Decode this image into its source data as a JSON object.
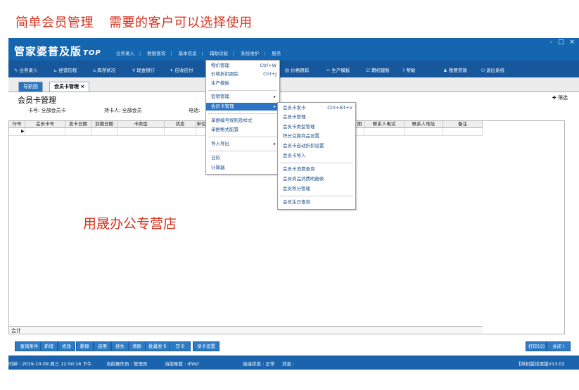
{
  "banner": {
    "part1": "简单会员管理",
    "part2": "需要的客户可以选择使用"
  },
  "app": {
    "logo": "管家婆",
    "edition": "普及版",
    "edition_suffix": "TOP"
  },
  "window_controls": [
    "-",
    "□",
    "×"
  ],
  "top_menu": [
    "业务录入",
    "数据查询",
    "基本信息",
    "辅助功能",
    "系统维护",
    "服务"
  ],
  "toolbar": [
    {
      "icon": "✎",
      "label": "业务录入"
    },
    {
      "icon": "⊾",
      "label": "经营历程"
    },
    {
      "icon": "⌂",
      "label": "库存状况"
    },
    {
      "icon": "¥",
      "label": "现金银行"
    },
    {
      "icon": "✦",
      "label": "应收应付"
    },
    {
      "icon": "▤",
      "label": "价格跟踪"
    },
    {
      "icon": "✂",
      "label": "生产模板"
    },
    {
      "icon": "☑",
      "label": "期初建账"
    },
    {
      "icon": "?",
      "label": "帮助"
    },
    {
      "icon": "♟",
      "label": "我要贷款"
    },
    {
      "icon": "⏻",
      "label": "退出系统"
    }
  ],
  "tabs": {
    "nav": "导航图",
    "current": "会员卡管理 ×"
  },
  "page_title": "会员卡管理",
  "filters": {
    "card_no": "卡号: 全部会员卡",
    "holder": "持卡人: 全部会员",
    "phone": "电话:"
  },
  "filter_button": "✚ 筛选",
  "table": {
    "columns": [
      "行号",
      "会员卡号",
      "发卡日期",
      "到期日期",
      "卡类型",
      "状态",
      "单位",
      "",
      "",
      "",
      "",
      "",
      "期",
      "联系人电话",
      "联系人地址",
      "备注"
    ],
    "total_label": "合计"
  },
  "menu1": {
    "items": [
      {
        "label": "物价管理",
        "shortcut": "Ctrl+W"
      },
      {
        "label": "价格折扣跟踪",
        "shortcut": "Ctrl+J"
      },
      {
        "label": "生产模板",
        "shortcut": ""
      },
      {
        "label": "促销管理",
        "shortcut": "▸"
      },
      {
        "label": "会员卡管理",
        "shortcut": "▸"
      },
      {
        "label": "单据编号规则及样式",
        "shortcut": ""
      },
      {
        "label": "单据格式配置",
        "shortcut": ""
      },
      {
        "label": "导入导出",
        "shortcut": "▸"
      },
      {
        "label": "日历",
        "shortcut": ""
      },
      {
        "label": "计算器",
        "shortcut": ""
      }
    ]
  },
  "menu2": {
    "items": [
      {
        "label": "会员卡发卡",
        "shortcut": "Ctrl+Alt+V"
      },
      {
        "label": "会员卡管理",
        "shortcut": ""
      },
      {
        "label": "会员卡类型管理",
        "shortcut": ""
      },
      {
        "label": "积分兑换商品设置",
        "shortcut": ""
      },
      {
        "label": "会员卡自动折扣设置",
        "shortcut": ""
      },
      {
        "label": "会员卡导入",
        "shortcut": ""
      },
      {
        "label": "会员卡消费查询",
        "shortcut": ""
      },
      {
        "label": "会员商品消费明细表",
        "shortcut": ""
      },
      {
        "label": "会员积分管理",
        "shortcut": ""
      },
      {
        "label": "会员生日查询",
        "shortcut": ""
      }
    ]
  },
  "watermark": "用晟办公专营店",
  "buttons": [
    "查询条件",
    "新增",
    "修改",
    "删除",
    "启用",
    "挂失",
    "清除",
    "批量发卡",
    "写卡",
    "读卡设置"
  ],
  "right_buttons": [
    "打印(Q)",
    "关闭 ("
  ],
  "status": {
    "time": "时钟 : 2019-10-09 周三 12:50:16 下午",
    "operator": "当前操作员 : 管理员",
    "account": "当前账套 : dfdsf",
    "connection": "连接状态 : 正常",
    "message": "消息 :",
    "version": "【单机版试用版V13.02"
  }
}
